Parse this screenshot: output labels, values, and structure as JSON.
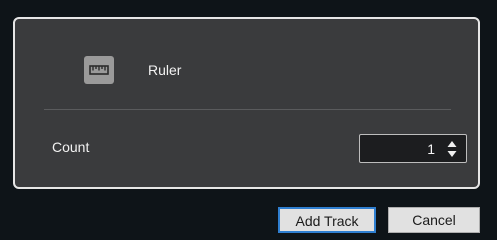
{
  "track": {
    "icon": "ruler-icon",
    "name": "Ruler"
  },
  "count": {
    "label": "Count",
    "value": "1"
  },
  "buttons": {
    "add_track": "Add Track",
    "cancel": "Cancel"
  },
  "colors": {
    "panel_bg": "#3a3b3d",
    "panel_border": "#e6e6e6",
    "window_bg": "#0e1418",
    "focus_accent": "#2f7fd0"
  }
}
